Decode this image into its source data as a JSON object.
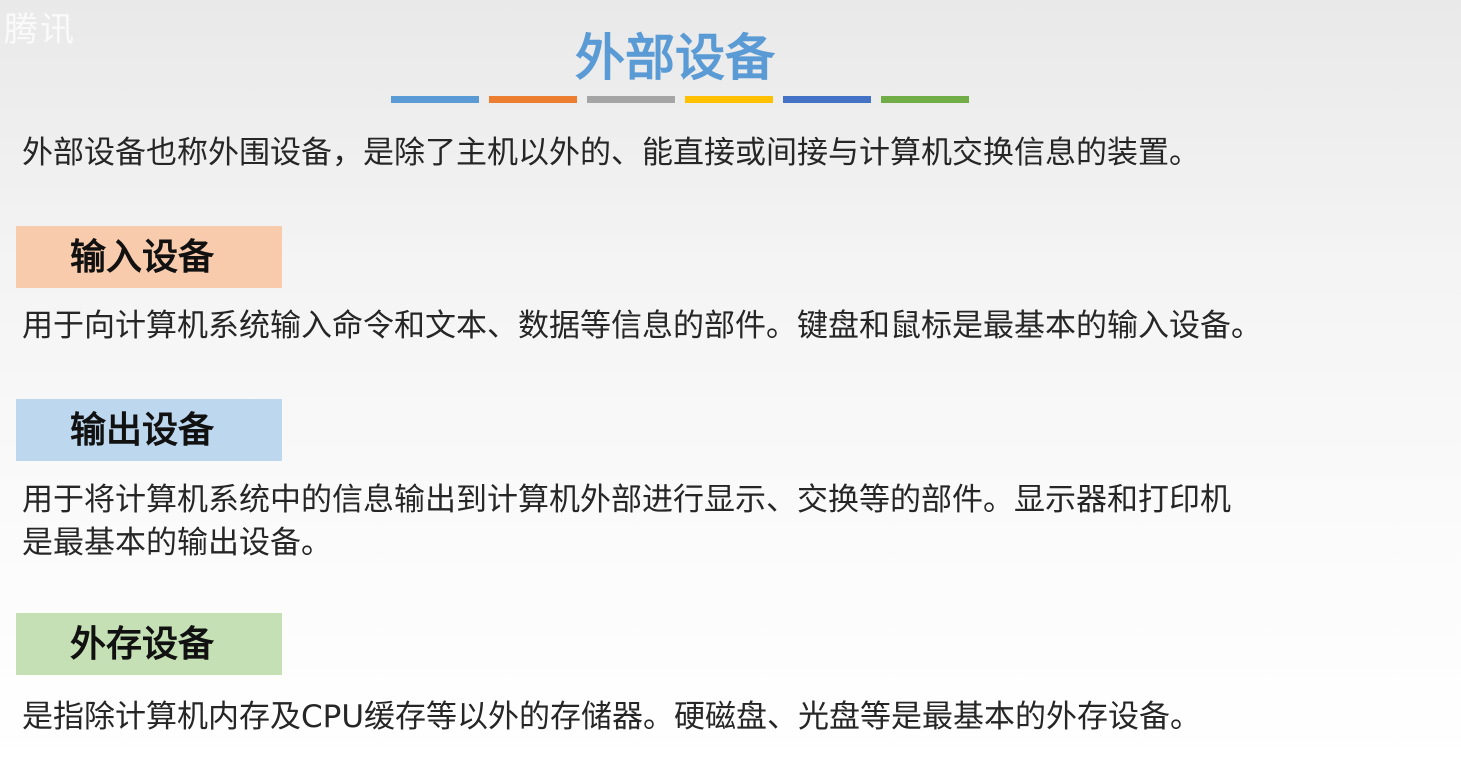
{
  "watermark": "腾讯",
  "title": "外部设备",
  "accent_bars": [
    "#5b9bd5",
    "#ed7d31",
    "#a5a5a5",
    "#ffc000",
    "#4472c4",
    "#70ad47"
  ],
  "intro": "外部设备也称外围设备，是除了主机以外的、能直接或间接与计算机交换信息的装置。",
  "sections": [
    {
      "label": "输入设备",
      "color": "#f8cbad",
      "description": "用于向计算机系统输入命令和文本、数据等信息的部件。键盘和鼠标是最基本的输入设备。"
    },
    {
      "label": "输出设备",
      "color": "#bdd7ee",
      "description_line1": "用于将计算机系统中的信息输出到计算机外部进行显示、交换等的部件。显示器和打印机",
      "description_line2": "是最基本的输出设备。"
    },
    {
      "label": "外存设备",
      "color": "#c5e0b4",
      "description": "是指除计算机内存及CPU缓存等以外的存储器。硬磁盘、光盘等是最基本的外存设备。"
    }
  ]
}
